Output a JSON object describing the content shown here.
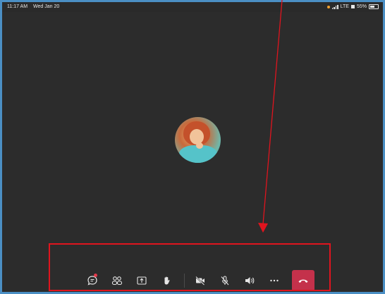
{
  "status_bar": {
    "time": "11:17 AM",
    "date": "Wed Jan 20",
    "network": "LTE",
    "battery": "55%",
    "battery_level": 0.55
  },
  "call": {
    "participant_avatar": "participant-photo"
  },
  "toolbar": {
    "buttons": [
      {
        "name": "chat",
        "icon": "chat-icon",
        "unread": true
      },
      {
        "name": "participants",
        "icon": "people-icon"
      },
      {
        "name": "share",
        "icon": "share-screen-icon"
      },
      {
        "name": "raise-hand",
        "icon": "raise-hand-icon"
      },
      {
        "name": "camera",
        "icon": "camera-off-icon"
      },
      {
        "name": "microphone",
        "icon": "mic-off-icon"
      },
      {
        "name": "speaker",
        "icon": "speaker-icon"
      },
      {
        "name": "more",
        "icon": "more-options-icon"
      },
      {
        "name": "hang-up",
        "icon": "end-call-icon"
      }
    ]
  },
  "annotation": {
    "highlight_color": "#e0141e"
  },
  "colors": {
    "background": "#2c2c2c",
    "end_call": "#c4314b",
    "border": "#4b8fc4"
  }
}
